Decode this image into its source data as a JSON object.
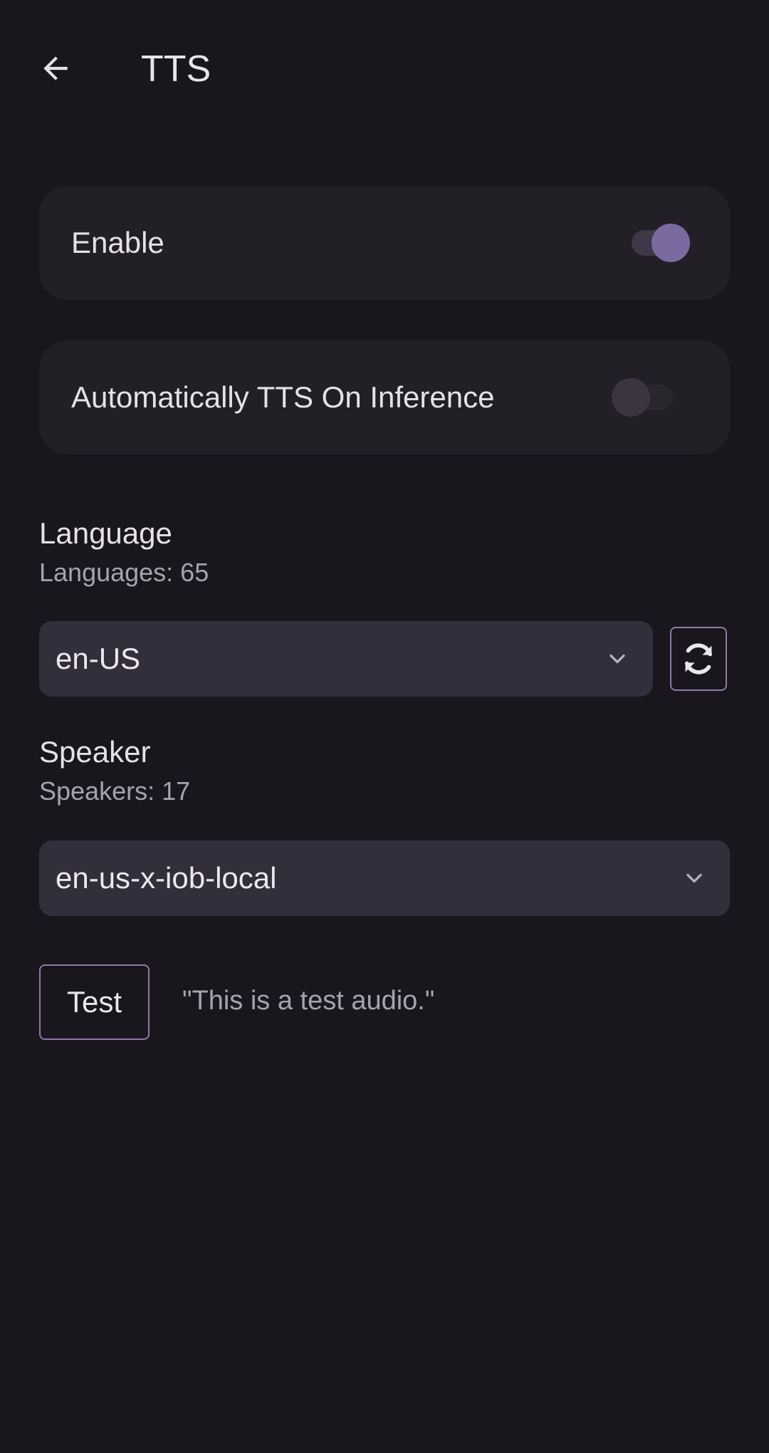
{
  "header": {
    "title": "TTS",
    "back_icon": "arrow-left-icon"
  },
  "settings": {
    "enable": {
      "label": "Enable",
      "on": true
    },
    "auto_tts": {
      "label": "Automatically TTS On Inference",
      "on": false
    }
  },
  "language": {
    "title": "Language",
    "count_text": "Languages: 65",
    "selected": "en-US",
    "refresh_icon": "refresh-icon"
  },
  "speaker": {
    "title": "Speaker",
    "count_text": "Speakers: 17",
    "selected": "en-us-x-iob-local"
  },
  "test": {
    "button_label": "Test",
    "sample_text": "\"This is a test audio.\""
  },
  "colors": {
    "background": "#19171d",
    "card": "#221f27",
    "accent": "#7b6aa0",
    "dropdown": "#332e3b",
    "outline": "#8d7aa8"
  }
}
